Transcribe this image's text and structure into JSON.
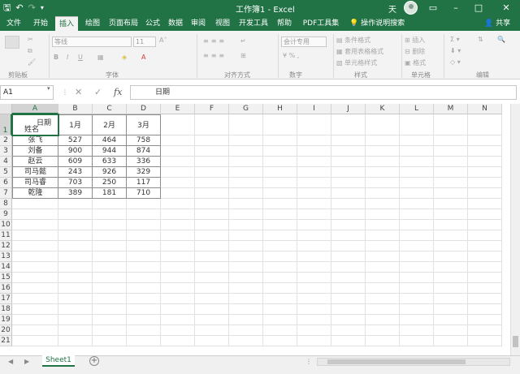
{
  "window": {
    "title": "工作簿1 - Excel",
    "user_initial": "天",
    "quick_access": [
      "save-icon",
      "undo-icon",
      "redo-icon",
      "customize-icon"
    ],
    "controls": [
      "ribbon-display-icon",
      "minimize-icon",
      "maximize-icon",
      "close-icon"
    ]
  },
  "ribbon": {
    "tabs": [
      "文件",
      "开始",
      "插入",
      "绘图",
      "页面布局",
      "公式",
      "数据",
      "审阅",
      "视图",
      "开发工具",
      "帮助",
      "PDF工具集"
    ],
    "active_tab": "插入",
    "tell_me": "操作说明搜索",
    "share": "共享",
    "font_name": "等线",
    "font_size": "11",
    "number_format": "会计专用",
    "style_items": [
      "条件格式",
      "套用表格格式",
      "单元格样式"
    ],
    "cell_items": [
      "插入",
      "删除",
      "格式"
    ],
    "group_labels": [
      "剪贴板",
      "字体",
      "对齐方式",
      "数字",
      "样式",
      "单元格",
      "编辑"
    ]
  },
  "formula_bar": {
    "name_box": "A1",
    "content": "日期"
  },
  "grid": {
    "columns": [
      "A",
      "B",
      "C",
      "D",
      "E",
      "F",
      "G",
      "H",
      "I",
      "J",
      "K",
      "L",
      "M",
      "N"
    ],
    "rows": [
      "1",
      "2",
      "3",
      "4",
      "5",
      "6",
      "7",
      "8",
      "9",
      "10",
      "11",
      "12",
      "13",
      "14",
      "15",
      "16",
      "17",
      "18",
      "19",
      "20",
      "21"
    ],
    "table": {
      "corner_top": "日期",
      "corner_bottom": "姓名",
      "headers": [
        "1月",
        "2月",
        "3月"
      ],
      "rows": [
        {
          "name": "张飞",
          "values": [
            "527",
            "464",
            "758"
          ]
        },
        {
          "name": "刘备",
          "values": [
            "900",
            "944",
            "874"
          ]
        },
        {
          "name": "赵云",
          "values": [
            "609",
            "633",
            "336"
          ]
        },
        {
          "name": "司马懿",
          "values": [
            "243",
            "926",
            "329"
          ]
        },
        {
          "name": "司马睿",
          "values": [
            "703",
            "250",
            "117"
          ]
        },
        {
          "name": "乾隆",
          "values": [
            "389",
            "181",
            "710"
          ]
        }
      ]
    }
  },
  "sheets": {
    "tabs": [
      "Sheet1"
    ],
    "active": "Sheet1"
  },
  "colors": {
    "accent": "#217346"
  }
}
